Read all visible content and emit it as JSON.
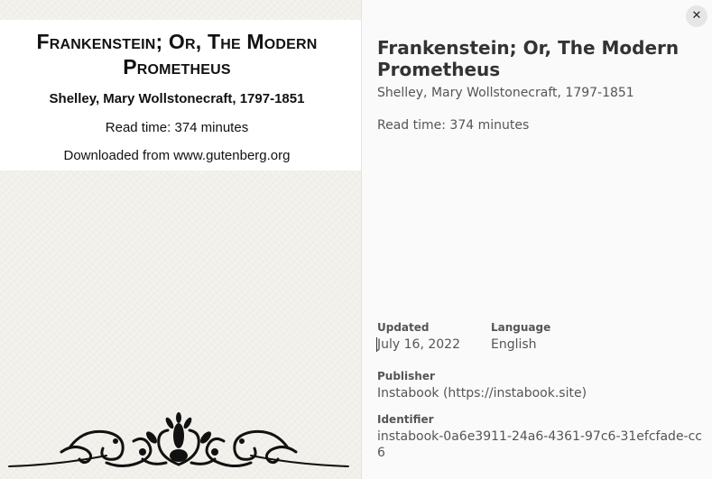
{
  "cover": {
    "title": "Frankenstein; Or, The Modern Prometheus",
    "author": "Shelley, Mary Wollstonecraft, 1797-1851",
    "read_time": "Read time: 374 minutes",
    "download_note": "Downloaded from www.gutenberg.org",
    "ornament_icon": "decorative-flourish-icon"
  },
  "details": {
    "title": "Frankenstein; Or, The Modern Prometheus",
    "author": "Shelley, Mary Wollstonecraft, 1797-1851",
    "read_time": "Read time: 374 minutes",
    "close_icon": "close-icon",
    "close_glyph": "✕",
    "meta": {
      "updated_label": "Updated",
      "updated_value": "July 16, 2022",
      "language_label": "Language",
      "language_value": "English",
      "publisher_label": "Publisher",
      "publisher_value": "Instabook (https://instabook.site)",
      "identifier_label": "Identifier",
      "identifier_value": "instabook-0a6e3911-24a6-4361-97c6-31efcfade-cc6"
    }
  }
}
